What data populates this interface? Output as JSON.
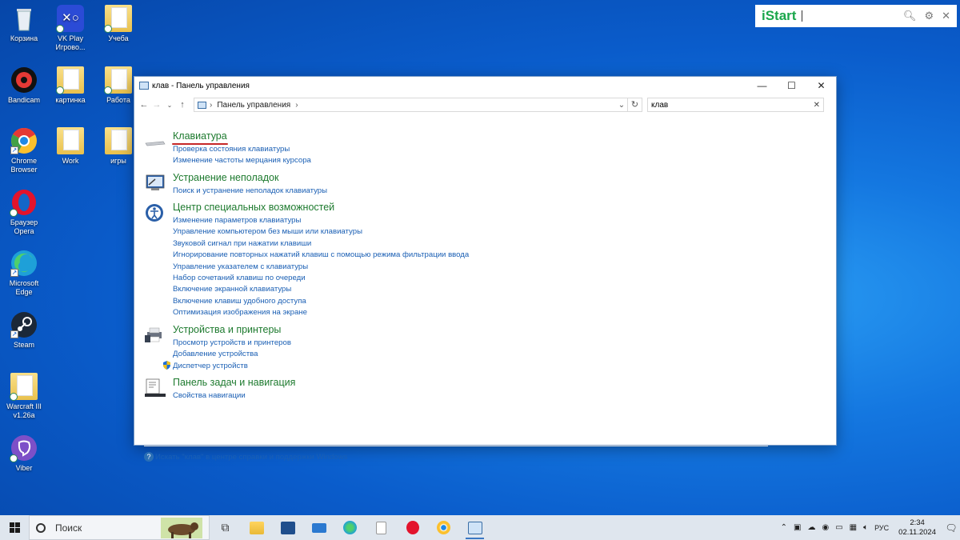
{
  "desktop": {
    "icons": [
      {
        "label": "Корзина"
      },
      {
        "label": "VK Play Игрово..."
      },
      {
        "label": "Учеба"
      },
      {
        "label": "Bandicam"
      },
      {
        "label": "картинка"
      },
      {
        "label": "Работа"
      },
      {
        "label": "Chrome Browser"
      },
      {
        "label": "Work"
      },
      {
        "label": "игры"
      },
      {
        "label": "Браузер Opera"
      },
      {
        "label": "Microsoft Edge"
      },
      {
        "label": "Steam"
      },
      {
        "label": "Warcraft III v1.26a"
      },
      {
        "label": "Viber"
      }
    ]
  },
  "istart": {
    "brand": "iStart",
    "icons": [
      "search-icon",
      "gear-icon",
      "close-icon"
    ]
  },
  "window": {
    "title": "клав - Панель управления",
    "address": "Панель управления",
    "search_value": "клав",
    "groups": [
      {
        "title": "Клавиатура",
        "icon": "keyboard-icon",
        "links": [
          "Проверка состояния клавиатуры",
          "Изменение частоты мерцания курсора"
        ]
      },
      {
        "title": "Устранение неполадок",
        "icon": "troubleshoot-icon",
        "links": [
          "Поиск и устранение неполадок клавиатуры"
        ]
      },
      {
        "title": "Центр специальных возможностей",
        "icon": "accessibility-icon",
        "links": [
          "Изменение параметров клавиатуры",
          "Управление компьютером без мыши или клавиатуры",
          "Звуковой сигнал при нажатии клавиши",
          "Игнорирование повторных нажатий клавиш с помощью режима фильтрации ввода",
          "Управление указателем с клавиатуры",
          "Набор сочетаний клавиш по очереди",
          "Включение экранной клавиатуры",
          "Включение клавиш удобного доступа",
          "Оптимизация изображения на экране"
        ]
      },
      {
        "title": "Устройства и принтеры",
        "icon": "printer-icon",
        "links": [
          "Просмотр устройств и принтеров",
          "Добавление устройства",
          "Диспетчер устройств"
        ]
      },
      {
        "title": "Панель задач и навигация",
        "icon": "taskbar-icon",
        "links": [
          "Свойства навигации"
        ]
      }
    ],
    "help_link": "Искать \"клав\" в центре справки и поддержки Windows"
  },
  "taskbar": {
    "search_placeholder": "Поиск",
    "language": "РУС",
    "time": "2:34",
    "date": "02.11.2024"
  }
}
